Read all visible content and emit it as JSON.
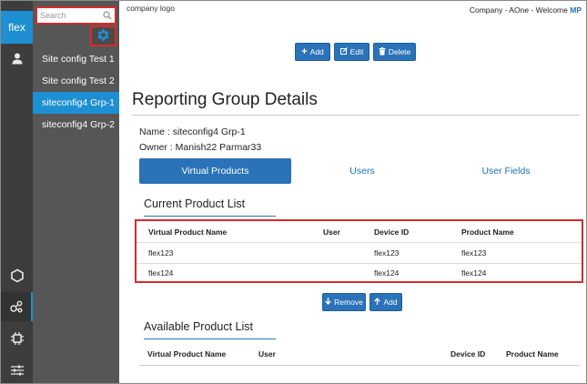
{
  "brand": {
    "label": "flex"
  },
  "search": {
    "placeholder": "Search"
  },
  "sidebar": {
    "items": [
      {
        "label": "Site config Test 1"
      },
      {
        "label": "Site config Test 2"
      },
      {
        "label": "siteconfig4 Grp-1"
      },
      {
        "label": "siteconfig4 Grp-2"
      }
    ],
    "active_index": 2
  },
  "rail": {
    "icons": [
      "user-icon",
      "hexagon-icon",
      "network-icon",
      "chip-icon",
      "sliders-icon"
    ],
    "active_icon": "network-icon"
  },
  "header": {
    "logo_text": "company logo",
    "welcome_prefix": "Company - AOne - Welcome",
    "user_initials": "MP"
  },
  "toolbar": {
    "add_label": "Add",
    "edit_label": "Edit",
    "delete_label": "Delete"
  },
  "page": {
    "title": "Reporting Group Details",
    "name_line": "Name : siteconfig4 Grp-1",
    "owner_line": "Owner : Manish22 Parmar33"
  },
  "tabs": [
    {
      "label": "Virtual Products",
      "active": true
    },
    {
      "label": "Users",
      "active": false
    },
    {
      "label": "User Fields",
      "active": false
    }
  ],
  "current_list": {
    "title": "Current Product List",
    "columns": [
      "Virtual Product Name",
      "User",
      "Device ID",
      "Product Name"
    ],
    "rows": [
      {
        "virtual_product_name": "flex123",
        "user": "",
        "device_id": "flex123",
        "product_name": "flex123"
      },
      {
        "virtual_product_name": "flex124",
        "user": "",
        "device_id": "flex124",
        "product_name": "flex124"
      }
    ]
  },
  "list_actions": {
    "remove_label": "Remove",
    "add_label": "Add"
  },
  "available_list": {
    "title": "Available Product List",
    "columns": [
      "Virtual Product Name",
      "User",
      "Device ID",
      "Product Name"
    ]
  },
  "colors": {
    "accent": "#1d8fd2",
    "button": "#2a73b8",
    "highlight_border": "#d62b2b",
    "rail": "#3d3d3d",
    "sidebar": "#565656"
  }
}
